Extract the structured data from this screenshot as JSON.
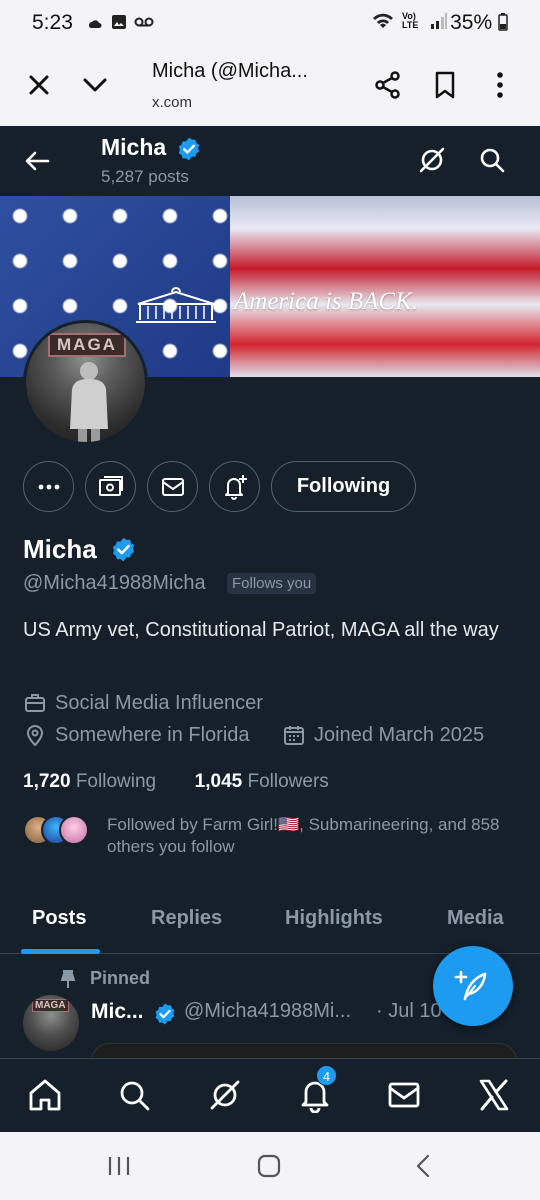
{
  "status_bar": {
    "time": "5:23",
    "battery": "35%",
    "network": "Vo) LTE"
  },
  "browser": {
    "title": "Micha (@Micha...",
    "url": "x.com"
  },
  "top_nav": {
    "name": "Micha",
    "posts": "5,287 posts"
  },
  "banner": {
    "slogan": "America is BACK."
  },
  "avatar": {
    "sign": "MAGA"
  },
  "actions": {
    "following_label": "Following"
  },
  "profile": {
    "name": "Micha",
    "handle": "@Micha41988Micha",
    "follows_you": "Follows you",
    "bio": "US Army vet, Constitutional Patriot, MAGA all the way",
    "category": "Social Media Influencer",
    "location": "Somewhere in Florida",
    "joined": "Joined March 2025",
    "following_count": "1,720",
    "following_label": "Following",
    "followers_count": "1,045",
    "followers_label": "Followers",
    "followed_by": "Followed by Farm Girl!🇺🇸, Submarineering, and 858 others you follow"
  },
  "tabs": [
    "Posts",
    "Replies",
    "Highlights",
    "Media"
  ],
  "pinned_post": {
    "pinned_label": "Pinned",
    "name": "Mic...",
    "handle": "@Micha41988Mi...",
    "date": "· Jul 10",
    "avatar_sign": "MAGA"
  },
  "notifications_badge": "4",
  "colors": {
    "background": "#15202b",
    "accent": "#1d9bf0",
    "muted": "#8b98a5"
  }
}
